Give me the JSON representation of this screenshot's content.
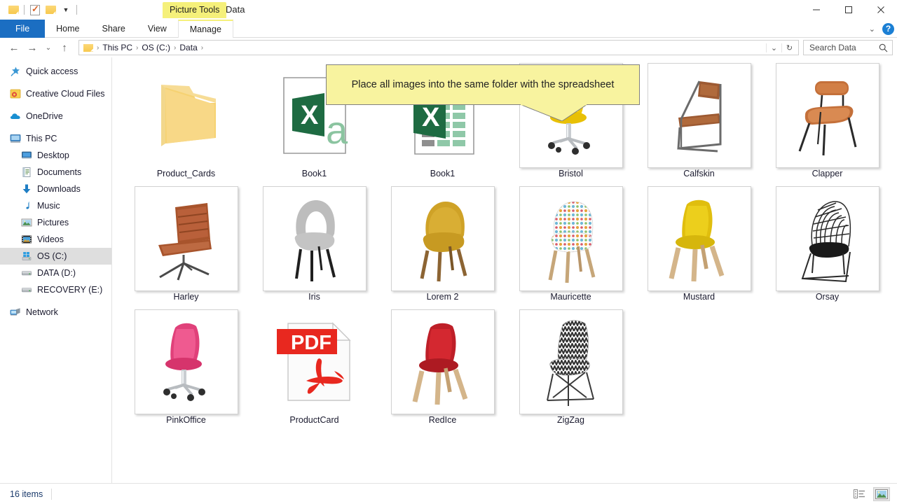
{
  "titlebar": {
    "quick_access": [
      {
        "name": "folder-icon",
        "label": "Properties"
      },
      {
        "name": "checkmark-document-icon",
        "label": "New folder"
      },
      {
        "name": "folder-icon",
        "label": "Customize Quick Access Toolbar"
      }
    ],
    "context_tab": "Picture Tools",
    "window_title": "Data",
    "minimize_label": "Minimize",
    "maximize_label": "Maximize",
    "close_label": "Close"
  },
  "ribbon": {
    "tabs": [
      {
        "label": "File",
        "active": false
      },
      {
        "label": "Home",
        "active": false
      },
      {
        "label": "Share",
        "active": false
      },
      {
        "label": "View",
        "active": false
      },
      {
        "label": "Manage",
        "active": true
      }
    ],
    "collapse_label": "⌄",
    "help_label": "?"
  },
  "address": {
    "back_label": "←",
    "forward_label": "→",
    "recent_label": "⌄",
    "up_label": "↑",
    "breadcrumb": [
      "This PC",
      "OS (C:)",
      "Data"
    ],
    "separator": "›",
    "dropdown_label": "⌄",
    "refresh_label": "↻",
    "search_placeholder": "Search Data"
  },
  "sidebar": {
    "items": [
      {
        "label": "Quick access",
        "icon": "star-pin-icon",
        "indent": false,
        "selected": false,
        "gap": false
      },
      {
        "label": "Creative Cloud Files",
        "icon": "creative-cloud-icon",
        "indent": false,
        "selected": false,
        "gap": true
      },
      {
        "label": "OneDrive",
        "icon": "cloud-icon",
        "indent": false,
        "selected": false,
        "gap": true
      },
      {
        "label": "This PC",
        "icon": "monitor-icon",
        "indent": false,
        "selected": false,
        "gap": true
      },
      {
        "label": "Desktop",
        "icon": "desktop-icon",
        "indent": true,
        "selected": false,
        "gap": false
      },
      {
        "label": "Documents",
        "icon": "documents-icon",
        "indent": true,
        "selected": false,
        "gap": false
      },
      {
        "label": "Downloads",
        "icon": "download-arrow-icon",
        "indent": true,
        "selected": false,
        "gap": false
      },
      {
        "label": "Music",
        "icon": "music-note-icon",
        "indent": true,
        "selected": false,
        "gap": false
      },
      {
        "label": "Pictures",
        "icon": "picture-icon",
        "indent": true,
        "selected": false,
        "gap": false
      },
      {
        "label": "Videos",
        "icon": "video-icon",
        "indent": true,
        "selected": false,
        "gap": false
      },
      {
        "label": "OS (C:)",
        "icon": "windows-drive-icon",
        "indent": true,
        "selected": true,
        "gap": false
      },
      {
        "label": "DATA (D:)",
        "icon": "drive-icon",
        "indent": true,
        "selected": false,
        "gap": false
      },
      {
        "label": "RECOVERY (E:)",
        "icon": "drive-icon",
        "indent": true,
        "selected": false,
        "gap": false
      },
      {
        "label": "Network",
        "icon": "network-icon",
        "indent": false,
        "selected": false,
        "gap": true
      }
    ]
  },
  "callout": {
    "text": "Place all images into the same folder with the spreadsheet",
    "background": "#f8f39f",
    "border": "#808080"
  },
  "files": [
    {
      "label": "Product_Cards",
      "type": "folder"
    },
    {
      "label": "Book1",
      "type": "csv"
    },
    {
      "label": "Book1",
      "type": "xlsx"
    },
    {
      "label": "Bristol",
      "type": "image",
      "subject": "yellow office chair with casters",
      "color": "#f2cc0c"
    },
    {
      "label": "Calfskin",
      "type": "image",
      "subject": "brown leather cantilever chair",
      "color": "#9c5b33"
    },
    {
      "label": "Clapper",
      "type": "image",
      "subject": "tan leather chair with black legs",
      "color": "#c4703a"
    },
    {
      "label": "Harley",
      "type": "image",
      "subject": "brown ribbed leather swivel chair",
      "color": "#a8542c"
    },
    {
      "label": "Iris",
      "type": "image",
      "subject": "grey tweed keyhole-back chair",
      "color": "#b9b9b9"
    },
    {
      "label": "Lorem 2",
      "type": "image",
      "subject": "mustard velvet chair with wood legs",
      "color": "#d0a32a"
    },
    {
      "label": "Mauricette",
      "type": "image",
      "subject": "polka dot patterned chair",
      "color": "#ececec"
    },
    {
      "label": "Mustard",
      "type": "image",
      "subject": "yellow shell chair with light wood legs",
      "color": "#e8c813"
    },
    {
      "label": "Orsay",
      "type": "image",
      "subject": "black wire mesh chair",
      "color": "#2b2b2b"
    },
    {
      "label": "PinkOffice",
      "type": "image",
      "subject": "pink office chair with casters",
      "color": "#e8457f"
    },
    {
      "label": "ProductCard",
      "type": "pdf"
    },
    {
      "label": "RedIce",
      "type": "image",
      "subject": "red shell chair with wood legs",
      "color": "#cc2026"
    },
    {
      "label": "ZigZag",
      "type": "image",
      "subject": "chevron patterned chair with wire base",
      "color": "#555555"
    }
  ],
  "statusbar": {
    "item_count": "16 items",
    "view_details_label": "Details view",
    "view_icons_label": "Large icons view"
  }
}
